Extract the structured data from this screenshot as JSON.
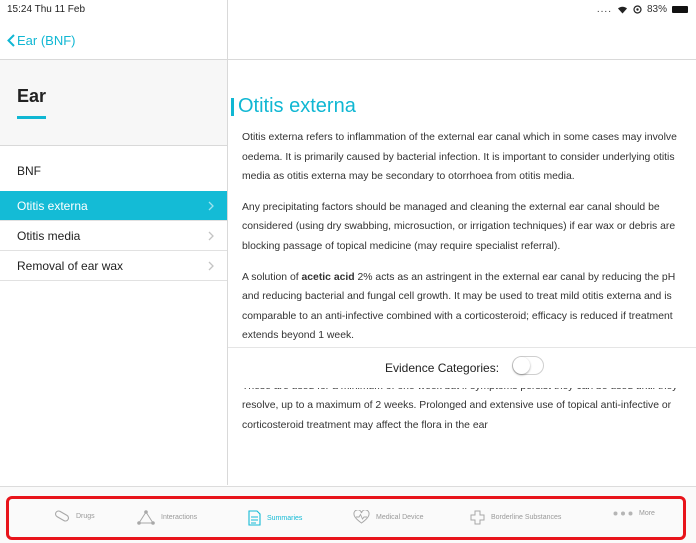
{
  "status_bar": {
    "time": "15:24  Thu 11 Feb",
    "battery_text": "83%"
  },
  "nav": {
    "back_label": "Ear (BNF)"
  },
  "sidebar": {
    "title": "Ear",
    "section_label": "BNF",
    "items": [
      {
        "label": "Otitis externa",
        "selected": true
      },
      {
        "label": "Otitis media",
        "selected": false
      },
      {
        "label": "Removal of ear wax",
        "selected": false
      }
    ]
  },
  "article": {
    "title": "Otitis externa",
    "p1": "Otitis externa refers to inflammation of the external ear canal which in some cases may involve oedema. It is primarily caused by bacterial infection. It is important to consider underlying otitis media as otitis externa may be secondary to otorrhoea from otitis media.",
    "p2": "Any precipitating factors should be managed and cleaning the external ear canal should be considered (using dry swabbing, microsuction, or irrigation techniques) if ear wax or debris are blocking passage of topical medicine (may require specialist referral).",
    "p3_pre": "A solution of ",
    "p3_bold": "acetic acid",
    "p3_post": " 2% acts as an astringent in the external ear canal by reducing the pH and reducing bacterial and fungal cell growth. It may be used to treat mild otitis externa and is comparable to an anti-infective combined with a corticosteroid; efficacy is reduced if treatment extends beyond 1 week.",
    "p4": "If infection is present, a topical anti-infective with or without a corticosteroid may be considered. These are used for a minimum of one week but if symptoms persist they can be used until they resolve, up to a maximum of 2 weeks. Prolonged and extensive use of topical anti-infective or corticosteroid treatment may affect the flora in the ear"
  },
  "evidence": {
    "label": "Evidence Categories:",
    "enabled": false
  },
  "tabbar": {
    "tabs": [
      {
        "label": "Drugs",
        "icon": "pill-icon"
      },
      {
        "label": "Interactions",
        "icon": "interactions-icon"
      },
      {
        "label": "Summaries",
        "icon": "document-icon",
        "active": true
      },
      {
        "label": "Medical Device",
        "icon": "heart-pulse-icon"
      },
      {
        "label": "Borderline Substances",
        "icon": "cross-icon"
      },
      {
        "label": "More",
        "icon": "more-dots-icon"
      }
    ]
  },
  "colors": {
    "accent": "#14bbd6",
    "highlight_box": "#e8141b"
  }
}
